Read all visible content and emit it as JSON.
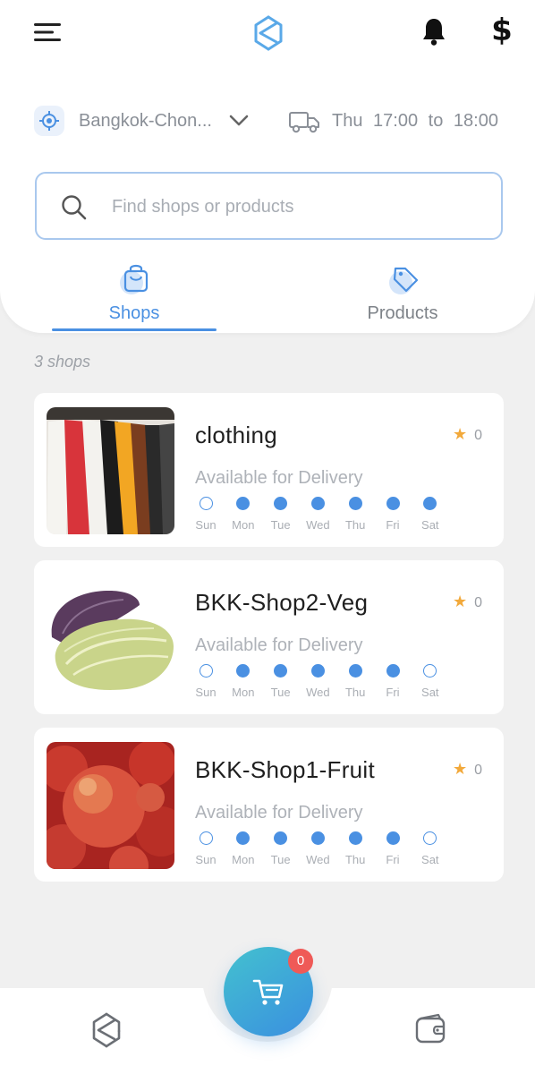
{
  "header": {
    "menu_icon": "menu-icon",
    "logo_icon": "app-logo-icon",
    "bell_icon": "bell-icon",
    "currency_symbol": "$"
  },
  "location": {
    "name": "Bangkok-Chon...",
    "delivery_day": "Thu",
    "delivery_from": "17:00",
    "delivery_to_word": "to",
    "delivery_to": "18:00"
  },
  "search": {
    "placeholder": "Find shops or products"
  },
  "tabs": [
    {
      "label": "Shops",
      "active": true,
      "icon": "shopping-bag-icon"
    },
    {
      "label": "Products",
      "active": false,
      "icon": "tag-icon"
    }
  ],
  "shops_count": "3 shops",
  "day_labels": [
    "Sun",
    "Mon",
    "Tue",
    "Wed",
    "Thu",
    "Fri",
    "Sat"
  ],
  "shops": [
    {
      "name": "clothing",
      "rating": "0",
      "availability_label": "Available for Delivery",
      "available_days": [
        false,
        true,
        true,
        true,
        true,
        true,
        true
      ]
    },
    {
      "name": "BKK-Shop2-Veg",
      "rating": "0",
      "availability_label": "Available for Delivery",
      "available_days": [
        false,
        true,
        true,
        true,
        true,
        true,
        false
      ]
    },
    {
      "name": "BKK-Shop1-Fruit",
      "rating": "0",
      "availability_label": "Available for Delivery",
      "available_days": [
        false,
        true,
        true,
        true,
        true,
        true,
        false
      ]
    }
  ],
  "cart": {
    "badge_count": "0"
  },
  "colors": {
    "accent": "#4a90e2",
    "star": "#f2a93b",
    "badge": "#ef5a57",
    "background": "#f0f0f0"
  }
}
